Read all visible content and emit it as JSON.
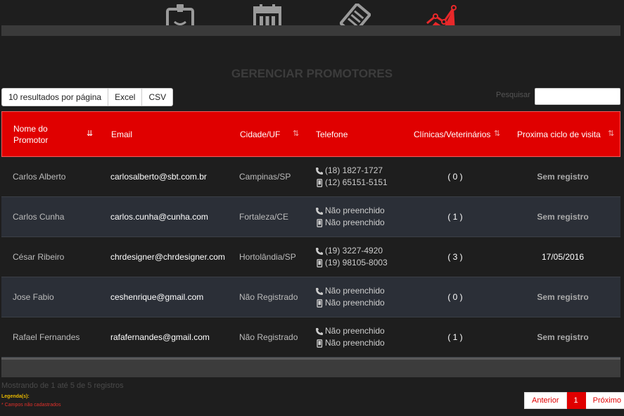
{
  "nav": {
    "icons": [
      {
        "name": "id-badge-icon",
        "active": false
      },
      {
        "name": "calendar-icon",
        "active": false
      },
      {
        "name": "tag-tickets-icon",
        "active": false
      },
      {
        "name": "line-chart-icon",
        "active": true
      }
    ],
    "accent": "#e8282a",
    "icon_color": "#9a9a9a"
  },
  "page": {
    "title": "GERENCIAR PROMOTORES"
  },
  "toolbar": {
    "page_size_label": "10 resultados por página",
    "excel_label": "Excel",
    "csv_label": "CSV",
    "search_label": "Pesquisar",
    "search_value": ""
  },
  "table": {
    "header_color": "#e00000",
    "columns": [
      "Nome do Promotor",
      "Email",
      "Cidade/UF",
      "Telefone",
      "Clínicas/Veterinários",
      "Proxima ciclo de visita"
    ],
    "rows": [
      {
        "name": "Carlos Alberto",
        "email": "carlosalberto@sbt.com.br",
        "city": "Campinas/SP",
        "phone": "(18) 1827-1727",
        "mobile": "(12) 65151-5151",
        "clinics": "( 0 )",
        "next_visit": "Sem registro"
      },
      {
        "name": "Carlos Cunha",
        "email": "carlos.cunha@cunha.com",
        "city": "Fortaleza/CE",
        "phone": "Não preenchido",
        "mobile": "Não preenchido",
        "clinics": "( 1 )",
        "next_visit": "Sem registro"
      },
      {
        "name": "César Ribeiro",
        "email": "chrdesigner@chrdesigner.com",
        "city": "Hortolândia/SP",
        "phone": "(19) 3227-4920",
        "mobile": "(19) 98105-8003",
        "clinics": "( 3 )",
        "next_visit": "17/05/2016"
      },
      {
        "name": "Jose Fabio",
        "email": "ceshenrique@gmail.com",
        "city": "Não Registrado",
        "phone": "Não preenchido",
        "mobile": "Não preenchido",
        "clinics": "( 0 )",
        "next_visit": "Sem registro"
      },
      {
        "name": "Rafael Fernandes",
        "email": "rafafernandes@gmail.com",
        "city": "Não Registrado",
        "phone": "Não preenchido",
        "mobile": "Não preenchido",
        "clinics": "( 1 )",
        "next_visit": "Sem registro"
      }
    ]
  },
  "footer": {
    "info": "Mostrando de 1 até 5 de 5 registros",
    "legend_title": "Legenda(s):",
    "legend_item": "* Campos não cadastrados"
  },
  "pagination": {
    "prev_label": "Anterior",
    "current_page": "1",
    "next_label": "Próximo"
  }
}
